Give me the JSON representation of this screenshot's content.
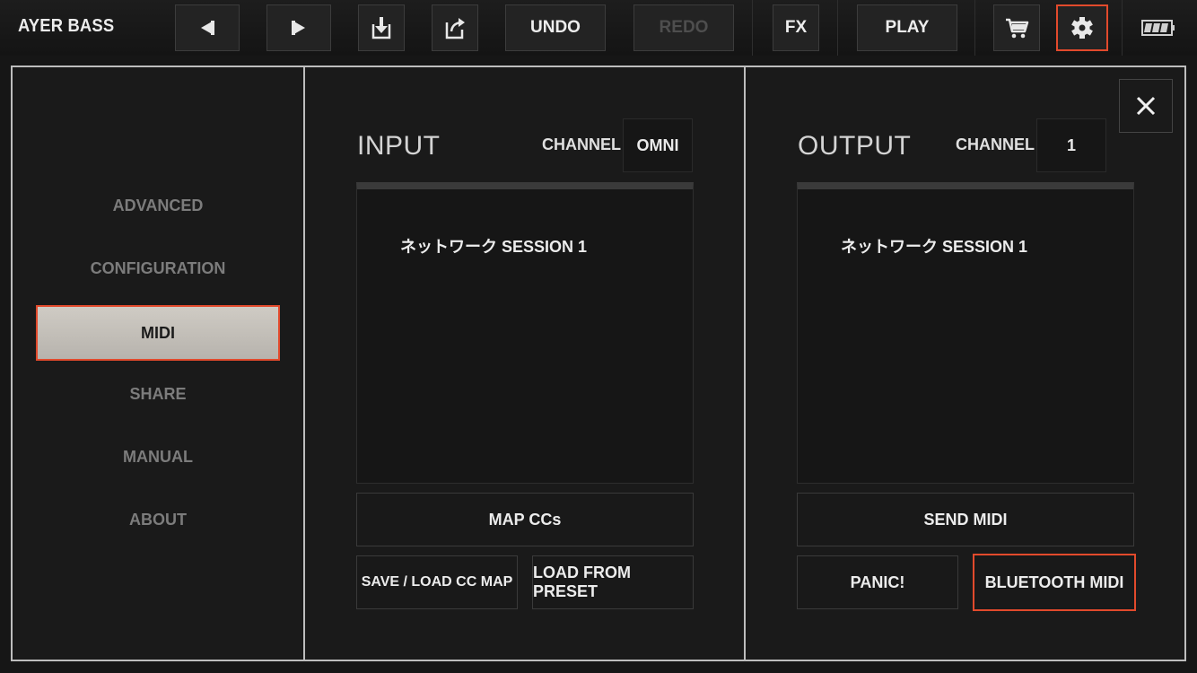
{
  "app": {
    "title": "AYER BASS"
  },
  "toolbar": {
    "undo_label": "UNDO",
    "redo_label": "REDO",
    "fx_label": "FX",
    "play_label": "PLAY",
    "icons": [
      "arrow-left-icon",
      "arrow-right-icon",
      "save-download-icon",
      "share-export-icon",
      "cart-icon",
      "gear-icon",
      "battery-icon"
    ]
  },
  "sidebar": {
    "items": [
      {
        "label": "ADVANCED"
      },
      {
        "label": "CONFIGURATION"
      },
      {
        "label": "MIDI",
        "active": true
      },
      {
        "label": "SHARE"
      },
      {
        "label": "MANUAL"
      },
      {
        "label": "ABOUT"
      }
    ]
  },
  "input": {
    "title": "INPUT",
    "channel_label": "CHANNEL",
    "channel_value": "OMNI",
    "devices": [
      "ネットワーク SESSION 1"
    ],
    "map_ccs_label": "MAP CCs",
    "save_load_label": "SAVE / LOAD CC MAP",
    "load_preset_label": "LOAD FROM PRESET"
  },
  "output": {
    "title": "OUTPUT",
    "channel_label": "CHANNEL",
    "channel_value": "1",
    "devices": [
      "ネットワーク SESSION 1"
    ],
    "send_midi_label": "SEND MIDI",
    "panic_label": "PANIC!",
    "bluetooth_label": "BLUETOOTH MIDI"
  },
  "colors": {
    "highlight": "#e24a2c",
    "frame": "#bdbdbd",
    "active_tab": "#c8c4be"
  }
}
